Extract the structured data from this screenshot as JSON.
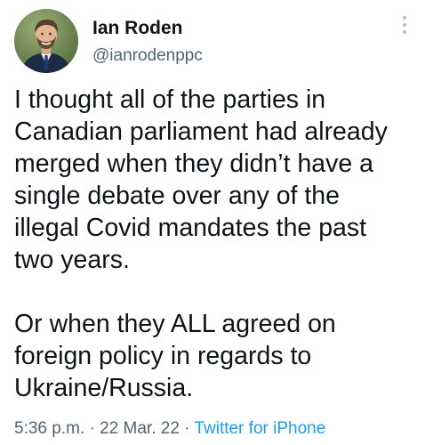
{
  "author": {
    "name": "Ian Roden",
    "handle": "@ianrodenppc",
    "avatar": "profile-photo"
  },
  "more_menu_icon": "vertical-ellipsis-icon",
  "tweet": {
    "paragraph_1": "I thought all of the parties in\nCanadian parliament had already\nmerged when they didn’t have a\nsingle debate over any of the\nillegal Covid mandates the past\ntwo years.",
    "paragraph_2": "Or when they ALL agreed on\nforeign policy in regards to\nUkraine/Russia."
  },
  "meta": {
    "time": "5:36 p.m.",
    "separator": "·",
    "date": "22 Mar. 22",
    "source": "Twitter for iPhone"
  },
  "colors": {
    "text": "#0f1419",
    "secondary": "#536471",
    "link": "#1d9bf0"
  }
}
